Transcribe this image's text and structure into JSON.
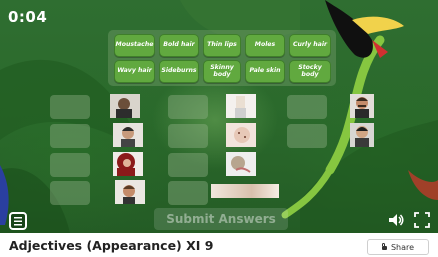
{
  "game": {
    "timer": "0:04",
    "word_bank": [
      "Moustache",
      "Bold hair",
      "Thin lips",
      "Moles",
      "Curly hair",
      "Wavy hair",
      "Sideburns",
      "Skinny body",
      "Pale skin",
      "Stocky body"
    ],
    "submit_label": "Submit Answers"
  },
  "footer": {
    "title": "Adjectives (Appearance) XI 9",
    "share_label": "Share"
  },
  "icons": [
    "menu-icon",
    "sound-icon",
    "fullscreen-icon",
    "lock-icon"
  ],
  "colors": {
    "chip": "#61a93f",
    "background": "#2f6e31"
  }
}
